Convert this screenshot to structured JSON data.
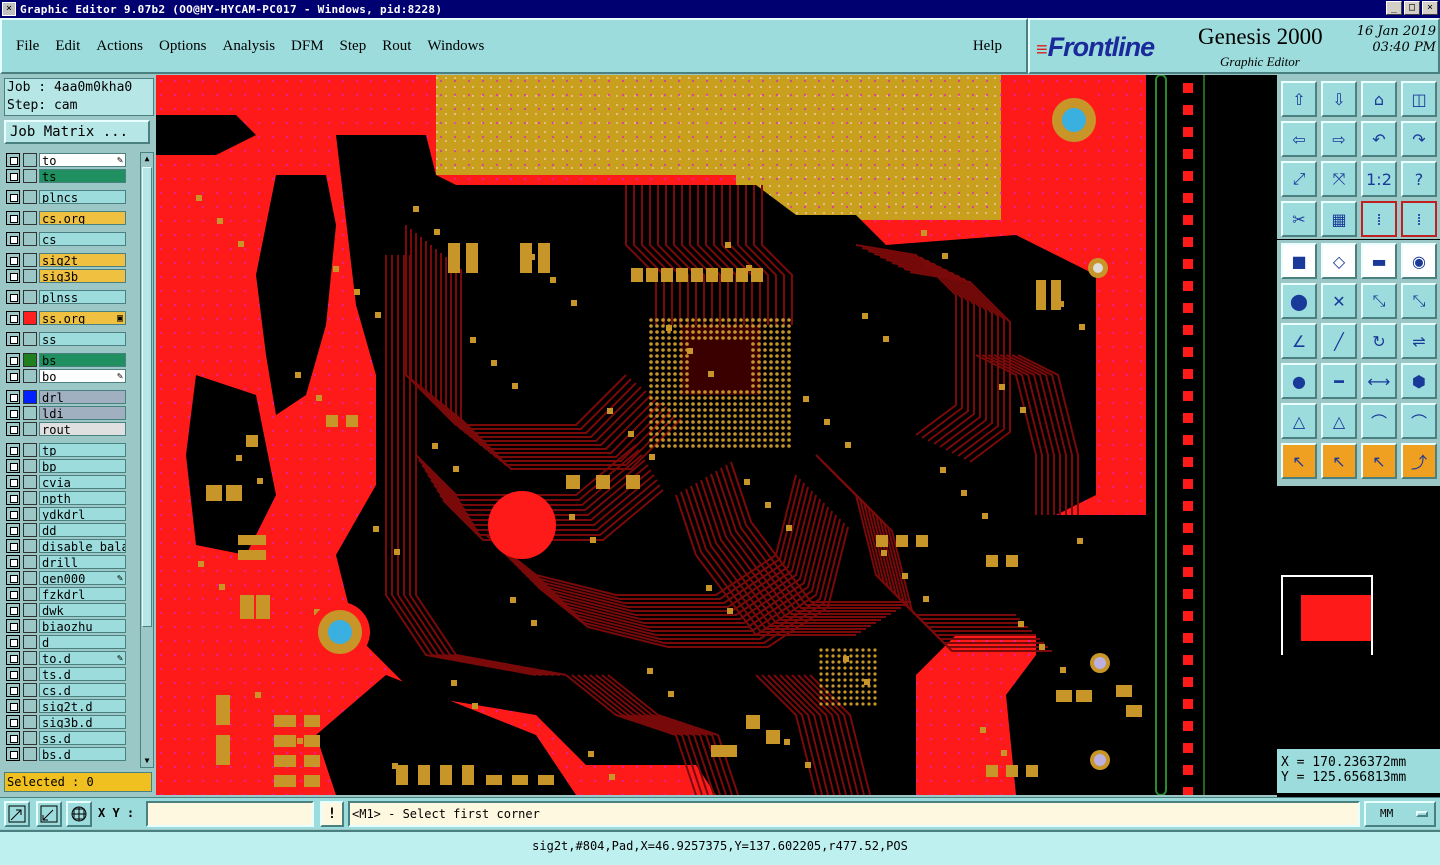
{
  "window": {
    "title": "Graphic Editor 9.07b2 (OO@HY-HYCAM-PC017 - Windows, pid:8228)",
    "buttons": [
      "_",
      "□",
      "×"
    ]
  },
  "menu": {
    "items": [
      "File",
      "Edit",
      "Actions",
      "Options",
      "Analysis",
      "DFM",
      "Step",
      "Rout",
      "Windows"
    ],
    "help": "Help"
  },
  "brand": {
    "logo": "Frontline",
    "product": "Genesis 2000",
    "subtitle": "Graphic Editor",
    "date": "16 Jan 2019",
    "time": "03:40 PM"
  },
  "job": {
    "job_line": "Job : 4aa0m0kha0",
    "step_line": "Step: cam",
    "matrix_button": "Job Matrix ..."
  },
  "layers": [
    {
      "name": "to",
      "bg": "#ffffff",
      "swatch": "",
      "mark": "✎"
    },
    {
      "name": "ts",
      "bg": "#209060",
      "swatch": "",
      "mark": ""
    },
    {
      "name": "plncs",
      "bg": "#9cdcdc",
      "swatch": "",
      "mark": ""
    },
    {
      "name": "cs.org",
      "bg": "#f0c040",
      "swatch": "",
      "mark": ""
    },
    {
      "name": "cs",
      "bg": "#9cdcdc",
      "swatch": "",
      "mark": ""
    },
    {
      "name": "sig2t",
      "bg": "#f0c040",
      "swatch": "",
      "mark": ""
    },
    {
      "name": "sig3b",
      "bg": "#f0c040",
      "swatch": "",
      "mark": ""
    },
    {
      "name": "plnss",
      "bg": "#9cdcdc",
      "swatch": "",
      "mark": ""
    },
    {
      "name": "ss.org",
      "bg": "#f0c040",
      "swatch": "#ff2020",
      "mark": "▣"
    },
    {
      "name": "ss",
      "bg": "#9cdcdc",
      "swatch": "",
      "mark": ""
    },
    {
      "name": "bs",
      "bg": "#209060",
      "swatch": "#208020",
      "mark": ""
    },
    {
      "name": "bo",
      "bg": "#ffffff",
      "swatch": "",
      "mark": "✎"
    },
    {
      "name": "drl",
      "bg": "#a0b0c0",
      "swatch": "#0020ff",
      "mark": ""
    },
    {
      "name": "ldi",
      "bg": "#a0b0c0",
      "swatch": "",
      "mark": ""
    },
    {
      "name": "rout",
      "bg": "#e0e0e0",
      "swatch": "",
      "mark": ""
    },
    {
      "name": "tp",
      "bg": "#9cdcdc",
      "swatch": "",
      "mark": ""
    },
    {
      "name": "bp",
      "bg": "#9cdcdc",
      "swatch": "",
      "mark": ""
    },
    {
      "name": "cvia",
      "bg": "#9cdcdc",
      "swatch": "",
      "mark": ""
    },
    {
      "name": "npth",
      "bg": "#9cdcdc",
      "swatch": "",
      "mark": ""
    },
    {
      "name": "ydkdrl",
      "bg": "#9cdcdc",
      "swatch": "",
      "mark": ""
    },
    {
      "name": "dd",
      "bg": "#9cdcdc",
      "swatch": "",
      "mark": ""
    },
    {
      "name": "disable_bala",
      "bg": "#9cdcdc",
      "swatch": "",
      "mark": ""
    },
    {
      "name": "drill",
      "bg": "#9cdcdc",
      "swatch": "",
      "mark": ""
    },
    {
      "name": "gen000",
      "bg": "#9cdcdc",
      "swatch": "",
      "mark": "✎"
    },
    {
      "name": "fzkdrl",
      "bg": "#9cdcdc",
      "swatch": "",
      "mark": ""
    },
    {
      "name": "dwk",
      "bg": "#9cdcdc",
      "swatch": "",
      "mark": ""
    },
    {
      "name": "biaozhu",
      "bg": "#9cdcdc",
      "swatch": "",
      "mark": ""
    },
    {
      "name": "d",
      "bg": "#9cdcdc",
      "swatch": "",
      "mark": ""
    },
    {
      "name": "to.d",
      "bg": "#9cdcdc",
      "swatch": "",
      "mark": "✎"
    },
    {
      "name": "ts.d",
      "bg": "#9cdcdc",
      "swatch": "",
      "mark": ""
    },
    {
      "name": "cs.d",
      "bg": "#9cdcdc",
      "swatch": "",
      "mark": ""
    },
    {
      "name": "sig2t.d",
      "bg": "#9cdcdc",
      "swatch": "",
      "mark": ""
    },
    {
      "name": "sig3b.d",
      "bg": "#9cdcdc",
      "swatch": "",
      "mark": ""
    },
    {
      "name": "ss.d",
      "bg": "#9cdcdc",
      "swatch": "",
      "mark": ""
    },
    {
      "name": "bs.d",
      "bg": "#9cdcdc",
      "swatch": "",
      "mark": ""
    }
  ],
  "selected_text": "Selected : 0",
  "toolbar_icons": [
    "zoom-home-icon",
    "zoom-down-icon",
    "home-icon",
    "window-split-icon",
    "pan-left-icon",
    "pan-right-icon",
    "undo-zoom-icon",
    "redo-zoom-icon",
    "fit-screen-icon",
    "fit-step-icon",
    "ratio-icon",
    "help-icon",
    "measure-icon",
    "grid-icon",
    "layer-sel-a-icon",
    "layer-sel-b-icon",
    "snap-pad-icon",
    "snap-edge-icon",
    "ruler-icon",
    "snap-center-icon",
    "connect-icon",
    "snap-x-icon",
    "snap-int-icon",
    "snap-end-icon",
    "angle-icon",
    "line-icon",
    "rotate-icon",
    "mirror-icon",
    "pad-icon",
    "slot-icon",
    "dimension-icon",
    "shape-icon",
    "cut-red-icon",
    "cut-blue-icon",
    "arc-icon",
    "arc-cut-icon",
    "pointer-icon",
    "select-icon",
    "select-box-icon",
    "route-icon"
  ],
  "coords": {
    "x_label": "X = 170.236372mm",
    "y_label": "Y = 125.656813mm"
  },
  "bottom": {
    "xy_label": "X Y :",
    "xy_value": "",
    "bang": "!",
    "prompt": "<M1> - Select first corner",
    "units": "MM",
    "status": "sig2t,#804,Pad,X=46.9257375,Y=137.602205,r477.52,POS"
  },
  "colors": {
    "copper": "#ff1a1a",
    "gold": "#c8a01e",
    "trace_dark": "#7a0a0a",
    "pad": "#c89628",
    "panel": "#9cdcdc"
  }
}
